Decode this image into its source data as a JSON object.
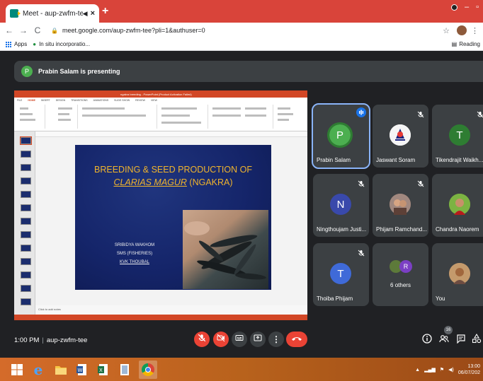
{
  "browser": {
    "tab_title": "Meet - aup-zwfm-tee",
    "tab_audio": "◀×",
    "tab_close": "×",
    "new_tab": "+",
    "url": "meet.google.com/aup-zwfm-tee?pli=1&authuser=0",
    "bookmarks": [
      {
        "label": "Apps"
      },
      {
        "label": "In situ incorporatio..."
      }
    ],
    "reading_list": "Reading"
  },
  "meet": {
    "presenting_banner": "Prabin Salam is presenting",
    "presenter_initial": "P",
    "meeting_time": "1:00 PM",
    "meeting_code": "aup-zwfm-tee",
    "people_count": "16",
    "participants": [
      {
        "name": "Prabin Salam",
        "initial": "P",
        "color": "#4caf50",
        "speaking": true
      },
      {
        "name": "Jaswant Soram",
        "type": "photo"
      },
      {
        "name": "Tikendrajit Waikh...",
        "initial": "T",
        "color": "#2e7d32"
      },
      {
        "name": "Ningthoujam Justi...",
        "initial": "N",
        "color": "#3949ab"
      },
      {
        "name": "Phijam Ramchand...",
        "type": "photo"
      },
      {
        "name": "Chandra Naorem",
        "type": "photo"
      },
      {
        "name": "Thoiba Phijam",
        "initial": "T",
        "color": "#3f6ad8"
      },
      {
        "name": "6 others",
        "initial": "R",
        "color": "#7b3fc4"
      },
      {
        "name": "You",
        "type": "photo"
      }
    ]
  },
  "slide": {
    "window_title": "ngakra breeding - PowerPoint (Product Activation Failed)",
    "ribbon_tabs": [
      "FILE",
      "HOME",
      "INSERT",
      "DESIGN",
      "TRANSITIONS",
      "ANIMATIONS",
      "SLIDE SHOW",
      "REVIEW",
      "VIEW"
    ],
    "title_line1": "BREEDING & SEED PRODUCTION OF",
    "title_species": "CLARIAS MAGUR",
    "title_local": " (NGAKRA)",
    "author": "SRIBIDYA WAKHOM",
    "role": "SMS (FISHERIES)",
    "org": "KVK THOUBAL",
    "notes_placeholder": "Click to add notes"
  },
  "taskbar": {
    "time": "13:00",
    "date": "06/07/202"
  },
  "colors": {
    "chrome_frame": "#d9443a",
    "meet_bg": "#202124",
    "tile_bg": "#3c4043",
    "end_call": "#ea4335",
    "slide_bg": "#15256a",
    "slide_title": "#f0b42c"
  }
}
